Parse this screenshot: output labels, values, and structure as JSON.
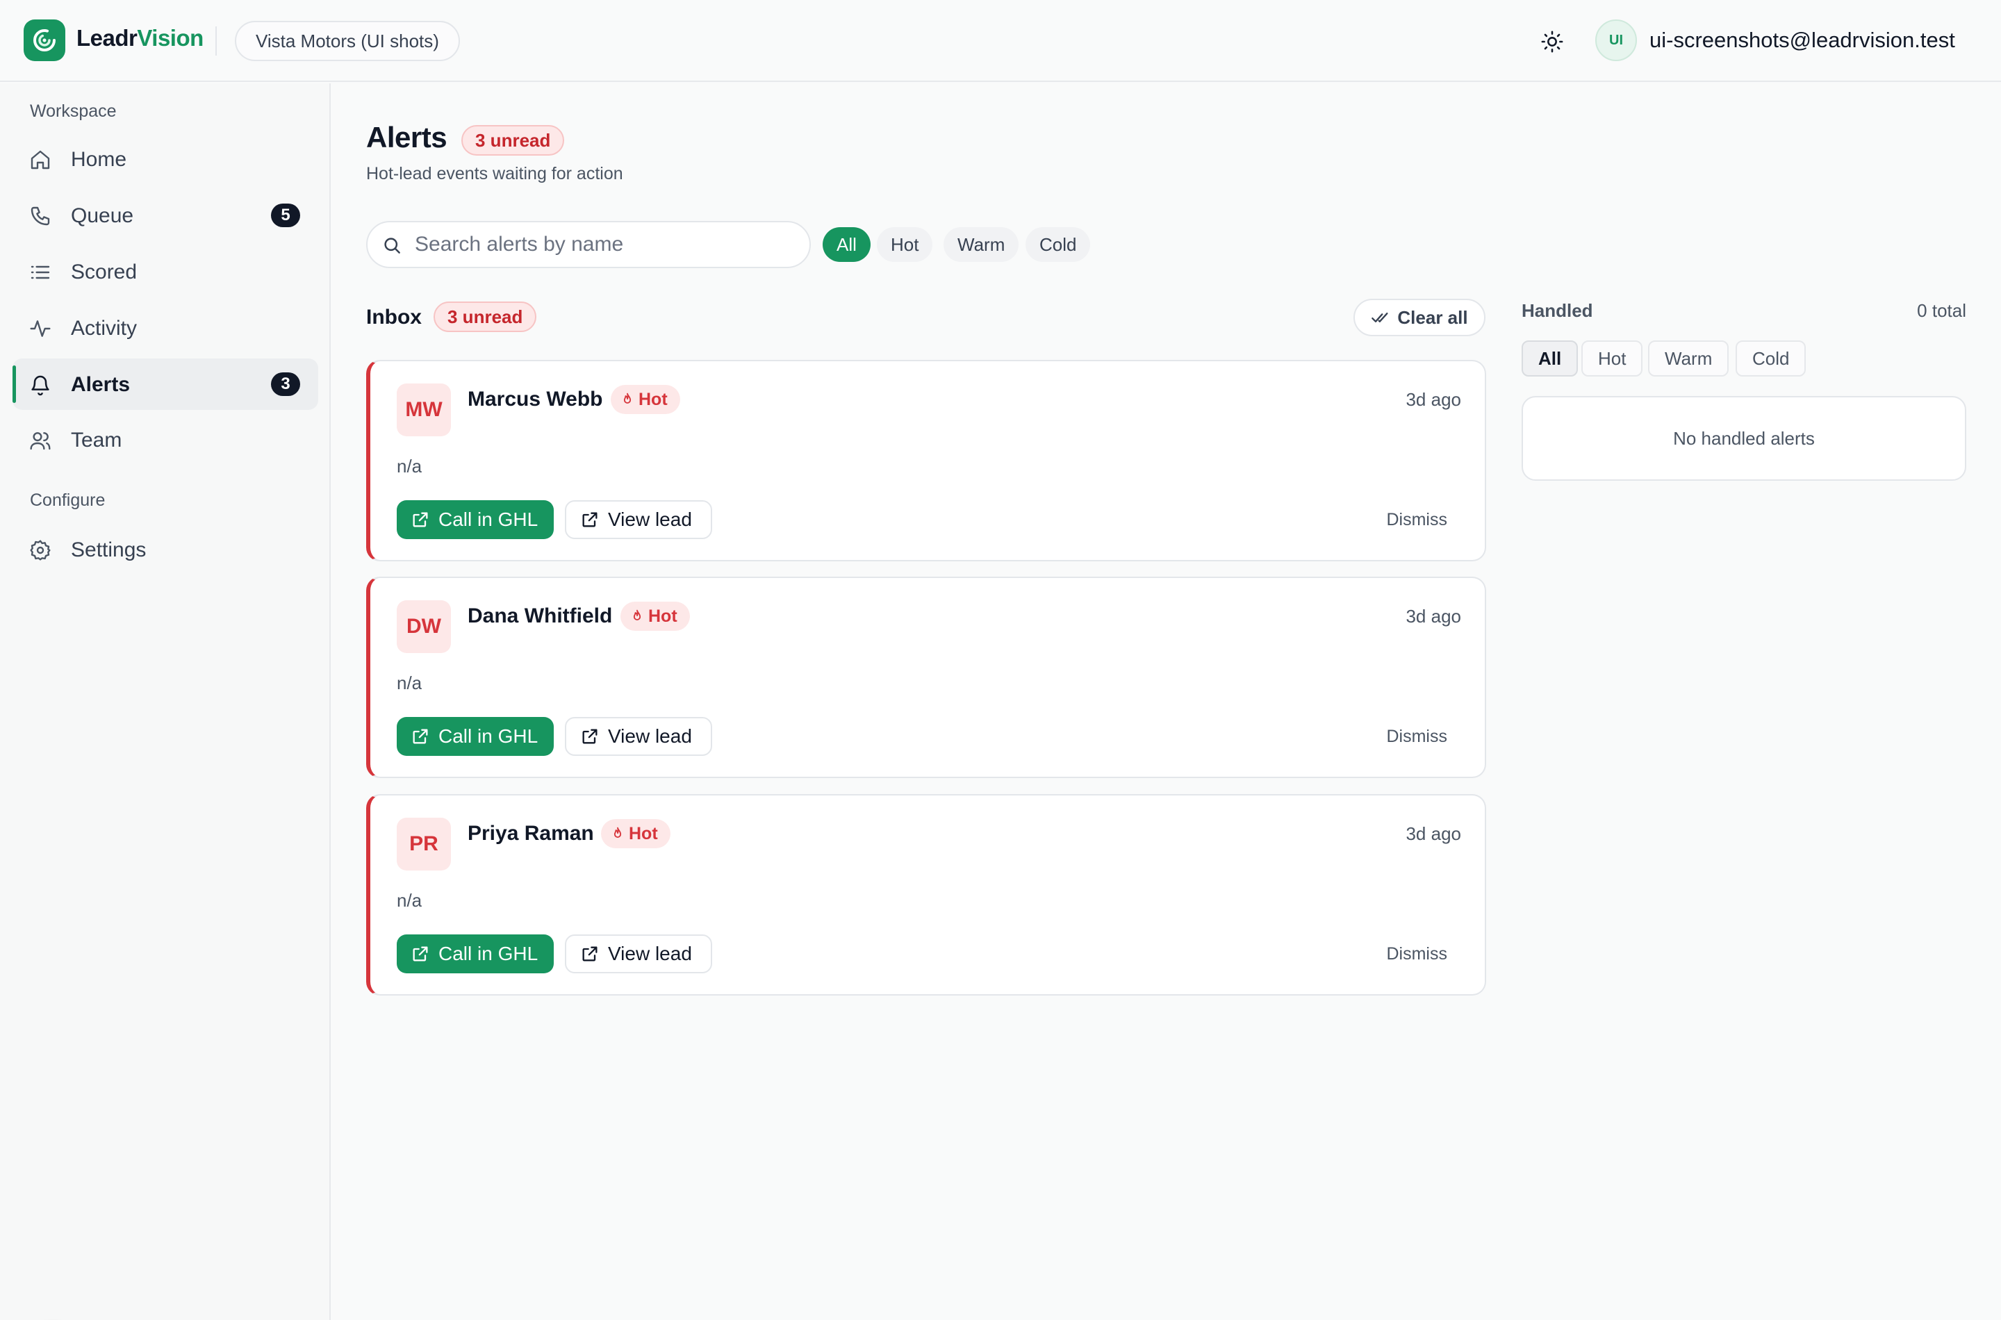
{
  "brand": {
    "part1": "Leadr",
    "part2": "Vision"
  },
  "workspace": "Vista Motors (UI shots)",
  "user": {
    "initials": "UI",
    "email": "ui-screenshots@leadrvision.test"
  },
  "sidebar": {
    "workspace_label": "Workspace",
    "configure_label": "Configure",
    "items": [
      {
        "label": "Home",
        "icon": "home-icon"
      },
      {
        "label": "Queue",
        "icon": "phone-icon",
        "badge": "5"
      },
      {
        "label": "Scored",
        "icon": "list-icon"
      },
      {
        "label": "Activity",
        "icon": "activity-icon"
      },
      {
        "label": "Alerts",
        "icon": "bell-icon",
        "badge": "3",
        "active": true
      },
      {
        "label": "Team",
        "icon": "users-icon"
      },
      {
        "label": "Settings",
        "icon": "gear-icon"
      }
    ]
  },
  "page": {
    "title": "Alerts",
    "unread_badge": "3 unread",
    "subtitle": "Hot-lead events waiting for action"
  },
  "search": {
    "placeholder": "Search alerts by name",
    "value": ""
  },
  "filters": {
    "all": "All",
    "hot": "Hot",
    "warm": "Warm",
    "cold": "Cold",
    "selected": "All"
  },
  "inbox": {
    "title": "Inbox",
    "unread_badge": "3 unread",
    "clear_label": "Clear all",
    "alerts": [
      {
        "initials": "MW",
        "name": "Marcus Webb",
        "temp": "Hot",
        "time": "3d ago",
        "summary": "n/a",
        "call_label": "Call in GHL",
        "view_label": "View lead",
        "dismiss_label": "Dismiss"
      },
      {
        "initials": "DW",
        "name": "Dana Whitfield",
        "temp": "Hot",
        "time": "3d ago",
        "summary": "n/a",
        "call_label": "Call in GHL",
        "view_label": "View lead",
        "dismiss_label": "Dismiss"
      },
      {
        "initials": "PR",
        "name": "Priya Raman",
        "temp": "Hot",
        "time": "3d ago",
        "summary": "n/a",
        "call_label": "Call in GHL",
        "view_label": "View lead",
        "dismiss_label": "Dismiss"
      }
    ]
  },
  "handled": {
    "title": "Handled",
    "total": "0 total",
    "filters": {
      "all": "All",
      "hot": "Hot",
      "warm": "Warm",
      "cold": "Cold",
      "selected": "All"
    },
    "empty_text": "No handled alerts"
  },
  "colors": {
    "accent": "#17955f",
    "hot": "#d6353b",
    "hot_bg": "#fde8e8"
  }
}
